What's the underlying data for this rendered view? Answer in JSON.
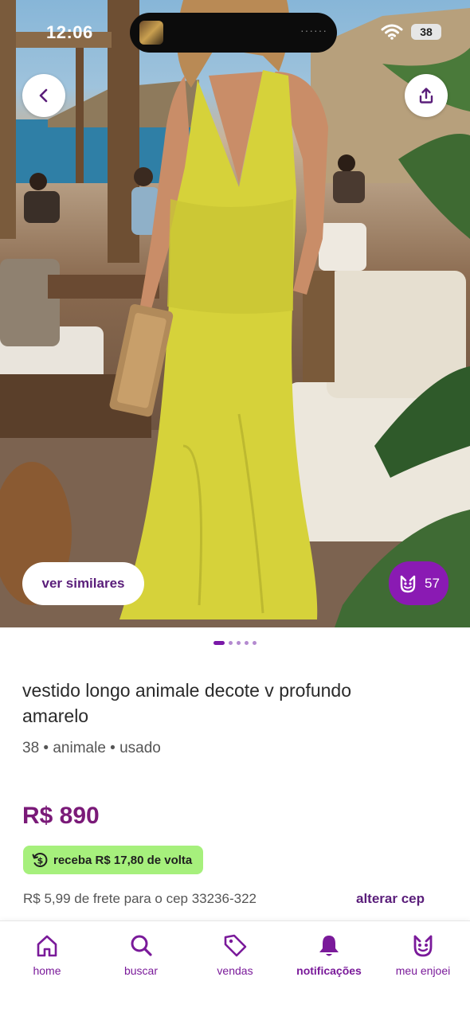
{
  "status_bar": {
    "time": "12:06",
    "battery": "38"
  },
  "hero": {
    "similar_label": "ver similares",
    "likes_count": "57",
    "pager": {
      "count": 5,
      "active": 0
    }
  },
  "product": {
    "title": "vestido longo animale decote v profundo amarelo",
    "meta": "38 • animale • usado",
    "price": "R$ 890",
    "cashback": "receba R$ 17,80 de volta",
    "freight": "R$ 5,99 de frete para o cep 33236-322",
    "change_cep": "alterar cep"
  },
  "nav": {
    "items": [
      {
        "label": "home",
        "icon": "home-icon"
      },
      {
        "label": "buscar",
        "icon": "search-icon"
      },
      {
        "label": "vendas",
        "icon": "tag-icon"
      },
      {
        "label": "notificações",
        "icon": "bell-icon"
      },
      {
        "label": "meu enjoei",
        "icon": "enjoei-face-icon"
      }
    ],
    "active_index": 3
  },
  "colors": {
    "brand_purple": "#7a1a78",
    "likes_purple": "#8a1ab3",
    "cashback_green": "#a6f07c",
    "dress_yellow": "#d6d23a"
  }
}
